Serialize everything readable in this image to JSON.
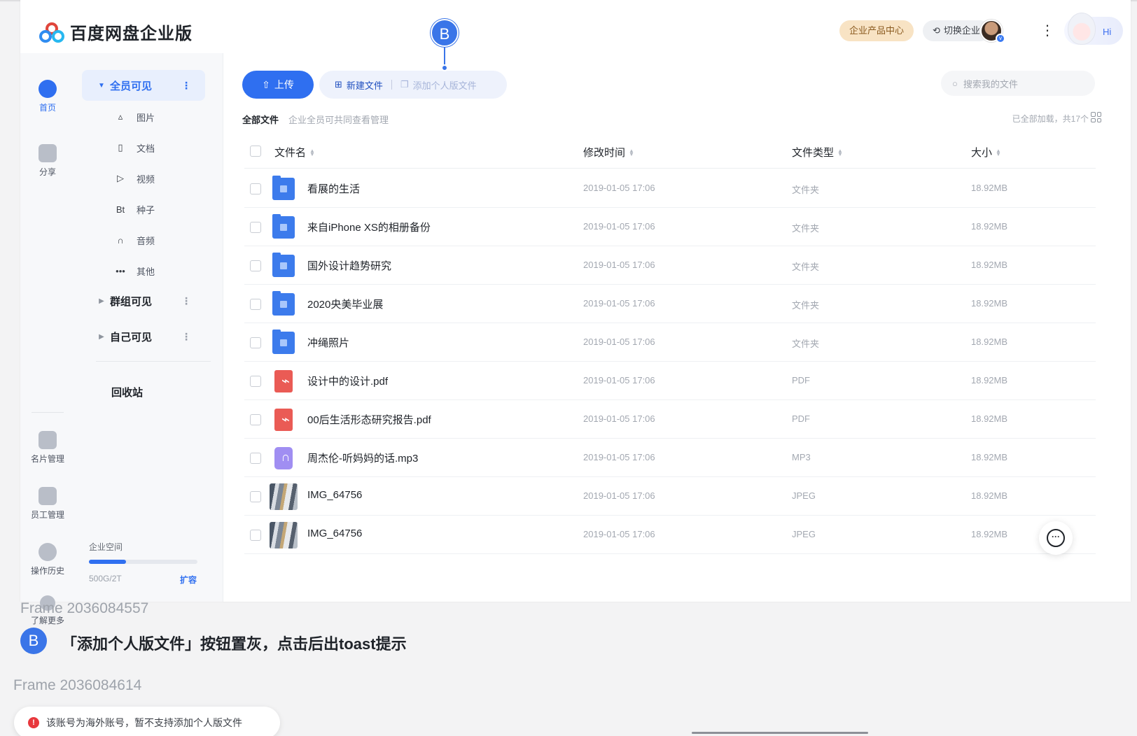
{
  "app": {
    "logo_text": "百度网盘企业版",
    "product_center": "企业产品中心",
    "switch_enterprise": "切换企业",
    "hi": "Hi"
  },
  "annotation": {
    "marker": "B"
  },
  "rail": {
    "items": [
      {
        "label": "首页",
        "icon": "cloud-icon"
      },
      {
        "label": "分享",
        "icon": "share-icon"
      },
      {
        "label": "名片管理",
        "icon": "card-icon"
      },
      {
        "label": "员工管理",
        "icon": "staff-icon"
      },
      {
        "label": "操作历史",
        "icon": "clock-icon"
      },
      {
        "label": "了解更多",
        "icon": "chat-icon"
      }
    ]
  },
  "subnav": {
    "groups": [
      {
        "label": "全员可见",
        "more": "⋮"
      },
      {
        "label": "群组可见",
        "more": "⋮"
      },
      {
        "label": "自己可见",
        "more": "⋮"
      }
    ],
    "items": [
      {
        "label": "图片",
        "icon": "▵"
      },
      {
        "label": "文档",
        "icon": "▯"
      },
      {
        "label": "视频",
        "icon": "▷"
      },
      {
        "label": "种子",
        "icon": "Bt"
      },
      {
        "label": "音频",
        "icon": "∩"
      },
      {
        "label": "其他",
        "icon": "•••"
      }
    ],
    "recycle": "回收站",
    "space": {
      "label": "企业空间",
      "value": "500G/2T",
      "expand": "扩容",
      "used_fraction": 0.34
    }
  },
  "toolbar": {
    "upload": "上传",
    "new_file": "新建文件",
    "add_personal": "添加个人版文件",
    "search_placeholder": "搜索我的文件"
  },
  "breadcrumb": {
    "title": "全部文件",
    "desc": "企业全员可共同查看管理",
    "loaded": "已全部加载，共17个"
  },
  "table": {
    "headers": [
      "文件名",
      "修改时间",
      "文件类型",
      "大小"
    ],
    "rows": [
      {
        "name": "看展的生活",
        "time": "2019-01-05 17:06",
        "type": "文件夹",
        "size": "18.92MB",
        "kind": "folder"
      },
      {
        "name": "来自iPhone XS的相册备份",
        "time": "2019-01-05 17:06",
        "type": "文件夹",
        "size": "18.92MB",
        "kind": "folder"
      },
      {
        "name": "国外设计趋势研究",
        "time": "2019-01-05 17:06",
        "type": "文件夹",
        "size": "18.92MB",
        "kind": "folder"
      },
      {
        "name": "2020央美毕业展",
        "time": "2019-01-05 17:06",
        "type": "文件夹",
        "size": "18.92MB",
        "kind": "folder"
      },
      {
        "name": "冲绳照片",
        "time": "2019-01-05 17:06",
        "type": "文件夹",
        "size": "18.92MB",
        "kind": "folder"
      },
      {
        "name": "设计中的设计.pdf",
        "time": "2019-01-05 17:06",
        "type": "PDF",
        "size": "18.92MB",
        "kind": "pdf"
      },
      {
        "name": "00后生活形态研究报告.pdf",
        "time": "2019-01-05 17:06",
        "type": "PDF",
        "size": "18.92MB",
        "kind": "pdf"
      },
      {
        "name": "周杰伦-听妈妈的话.mp3",
        "time": "2019-01-05 17:06",
        "type": "MP3",
        "size": "18.92MB",
        "kind": "mp3"
      },
      {
        "name": "IMG_64756",
        "time": "2019-01-05 17:06",
        "type": "JPEG",
        "size": "18.92MB",
        "kind": "photo"
      },
      {
        "name": "IMG_64756",
        "time": "2019-01-05 17:06",
        "type": "JPEG",
        "size": "18.92MB",
        "kind": "photo"
      }
    ]
  },
  "notes": {
    "frame1": "Frame 2036084557",
    "frame2": "Frame 2036084614",
    "marker": "B",
    "description": "「添加个人版文件」按钮置灰，点击后出toast提示",
    "toast": "该账号为海外账号，暂不支持添加个人版文件",
    "toast_icon": "!"
  },
  "colors": {
    "accent": "#2f6ff0",
    "folder": "#3c7bec",
    "pdf": "#ea5b55",
    "mp3": "#a08ef2",
    "annotation": "#3a75e8",
    "error": "#e8383d"
  }
}
